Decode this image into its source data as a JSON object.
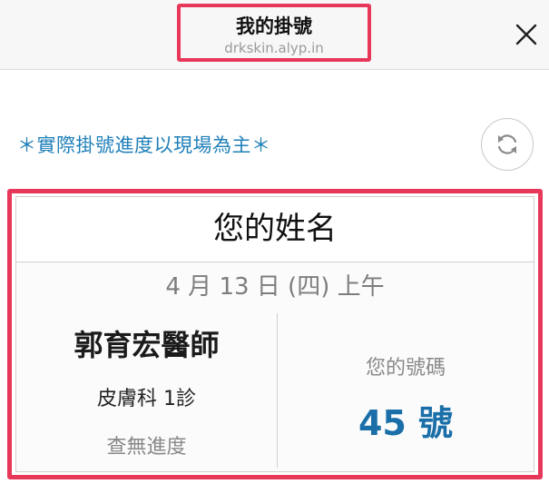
{
  "header": {
    "title": "我的掛號",
    "url": "drkskin.alyp.in",
    "close_icon": "close-icon"
  },
  "notice": {
    "text": "＊實際掛號進度以現場為主＊",
    "refresh_icon": "refresh-icon"
  },
  "card": {
    "patient_name": "您的姓名",
    "date": "4 月 13 日 (四) 上午",
    "doctor": "郭育宏醫師",
    "department": "皮膚科 1診",
    "progress_status": "查無進度",
    "number_label": "您的號碼",
    "number": "45 號"
  },
  "colors": {
    "highlight": "#e8385a",
    "accent": "#1a6fa8",
    "notice": "#1e7fb8"
  }
}
